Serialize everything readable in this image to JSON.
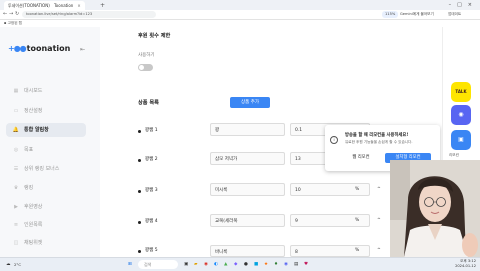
{
  "browser": {
    "tabs": [
      {
        "title": "투네이션(TOONATION)",
        "active": false
      },
      {
        "title": "Toonation",
        "active": true
      }
    ],
    "new_tab": "+",
    "url": "toonation.live/set/ring/alarm?id=123",
    "extensions": [
      "115%",
      "Gemini에게 물어보기"
    ],
    "extension_right": "업데이트",
    "bookmark": "고정된 탭"
  },
  "sidebar": {
    "logo_text": "toonation",
    "items": [
      {
        "label": "대시보드",
        "icon": "dashboard-icon"
      },
      {
        "label": "정산설정",
        "icon": "wallet-icon"
      },
      {
        "label": "통합 알림창",
        "icon": "bell-icon",
        "active": true
      },
      {
        "label": "목표",
        "icon": "target-icon"
      },
      {
        "label": "상위 랭킹 보너스",
        "icon": "ranking-icon"
      },
      {
        "label": "랭킹",
        "icon": "trophy-icon"
      },
      {
        "label": "후원영상",
        "icon": "video-icon"
      },
      {
        "label": "인원목록",
        "icon": "list-icon"
      },
      {
        "label": "채팅위젯",
        "icon": "chat-icon"
      }
    ]
  },
  "main": {
    "limit_title": "후원 횟수 제한",
    "use_label": "사용하기",
    "products_title": "상품 목록",
    "add_button": "상품 추가",
    "products": [
      {
        "label": "꽝쌤 1",
        "name": "꽝",
        "value": "0.1"
      },
      {
        "label": "꽝쌤 2",
        "name": "삼모 저녁가",
        "value": "13"
      },
      {
        "label": "꽝쌤 3",
        "name": "미시룩",
        "value": "10"
      },
      {
        "label": "꽝쌤 4",
        "name": "교복(세라복",
        "value": "9"
      },
      {
        "label": "꽝쌤 5",
        "name": "바니룩",
        "value": "8"
      }
    ],
    "percent_sign": "%",
    "caret": "^"
  },
  "popup": {
    "title": "방송을 할 때 리모컨을 사용하세요!",
    "desc": "유료한 후원 기능들을 손쉽게 할 수 있습니다.",
    "secondary": "웹 리모컨",
    "primary": "설치형 리모컨"
  },
  "right_apps": [
    {
      "icon": "kakaotalk-icon",
      "glyph": "TALK",
      "color": "#fee500",
      "text_color": "#3b1e1e"
    },
    {
      "icon": "discord-icon",
      "glyph": "◉",
      "color": "#5865f2",
      "text_color": "#ffffff"
    },
    {
      "icon": "remote-icon",
      "glyph": "▣",
      "color": "#3a86f4",
      "text_color": "#ffffff",
      "label": "리모컨"
    }
  ],
  "taskbar": {
    "search_placeholder": "검색",
    "weather": "2°C",
    "clock_time": "오후 3:12",
    "clock_date": "2024-01-12"
  }
}
